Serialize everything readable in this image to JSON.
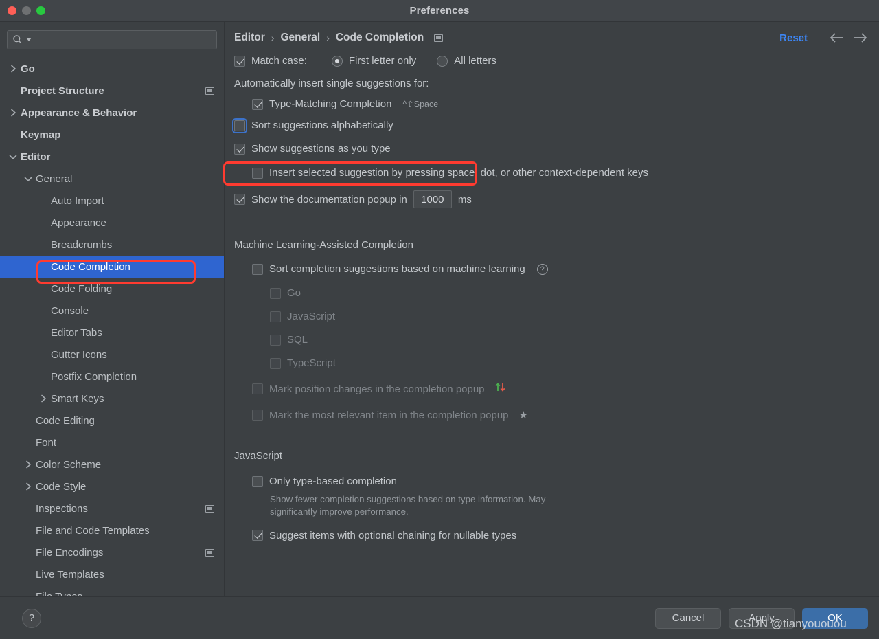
{
  "window": {
    "title": "Preferences",
    "traffic_lights": [
      "close",
      "minimize",
      "zoom"
    ]
  },
  "sidebar": {
    "search": {
      "placeholder": "",
      "value": ""
    },
    "items": [
      {
        "label": "Go",
        "arrow": "right",
        "bold": true,
        "indent": 0,
        "badge": false,
        "selected": false
      },
      {
        "label": "Project Structure",
        "arrow": "none",
        "bold": true,
        "indent": 0,
        "badge": true,
        "selected": false
      },
      {
        "label": "Appearance & Behavior",
        "arrow": "right",
        "bold": true,
        "indent": 0,
        "badge": false,
        "selected": false
      },
      {
        "label": "Keymap",
        "arrow": "none",
        "bold": true,
        "indent": 0,
        "badge": false,
        "selected": false
      },
      {
        "label": "Editor",
        "arrow": "down",
        "bold": true,
        "indent": 0,
        "badge": false,
        "selected": false
      },
      {
        "label": "General",
        "arrow": "down",
        "bold": false,
        "indent": 1,
        "badge": false,
        "selected": false
      },
      {
        "label": "Auto Import",
        "arrow": "none",
        "bold": false,
        "indent": 2,
        "badge": false,
        "selected": false
      },
      {
        "label": "Appearance",
        "arrow": "none",
        "bold": false,
        "indent": 2,
        "badge": false,
        "selected": false
      },
      {
        "label": "Breadcrumbs",
        "arrow": "none",
        "bold": false,
        "indent": 2,
        "badge": false,
        "selected": false
      },
      {
        "label": "Code Completion",
        "arrow": "none",
        "bold": false,
        "indent": 2,
        "badge": false,
        "selected": true
      },
      {
        "label": "Code Folding",
        "arrow": "none",
        "bold": false,
        "indent": 2,
        "badge": false,
        "selected": false
      },
      {
        "label": "Console",
        "arrow": "none",
        "bold": false,
        "indent": 2,
        "badge": false,
        "selected": false
      },
      {
        "label": "Editor Tabs",
        "arrow": "none",
        "bold": false,
        "indent": 2,
        "badge": false,
        "selected": false
      },
      {
        "label": "Gutter Icons",
        "arrow": "none",
        "bold": false,
        "indent": 2,
        "badge": false,
        "selected": false
      },
      {
        "label": "Postfix Completion",
        "arrow": "none",
        "bold": false,
        "indent": 2,
        "badge": false,
        "selected": false
      },
      {
        "label": "Smart Keys",
        "arrow": "right",
        "bold": false,
        "indent": 2,
        "badge": false,
        "selected": false
      },
      {
        "label": "Code Editing",
        "arrow": "none",
        "bold": false,
        "indent": 1,
        "badge": false,
        "selected": false
      },
      {
        "label": "Font",
        "arrow": "none",
        "bold": false,
        "indent": 1,
        "badge": false,
        "selected": false
      },
      {
        "label": "Color Scheme",
        "arrow": "right",
        "bold": false,
        "indent": 1,
        "badge": false,
        "selected": false
      },
      {
        "label": "Code Style",
        "arrow": "right",
        "bold": false,
        "indent": 1,
        "badge": false,
        "selected": false
      },
      {
        "label": "Inspections",
        "arrow": "none",
        "bold": false,
        "indent": 1,
        "badge": true,
        "selected": false
      },
      {
        "label": "File and Code Templates",
        "arrow": "none",
        "bold": false,
        "indent": 1,
        "badge": false,
        "selected": false
      },
      {
        "label": "File Encodings",
        "arrow": "none",
        "bold": false,
        "indent": 1,
        "badge": true,
        "selected": false
      },
      {
        "label": "Live Templates",
        "arrow": "none",
        "bold": false,
        "indent": 1,
        "badge": false,
        "selected": false
      },
      {
        "label": "File Types",
        "arrow": "none",
        "bold": false,
        "indent": 1,
        "badge": false,
        "selected": false
      }
    ]
  },
  "breadcrumb": {
    "parts": [
      "Editor",
      "General",
      "Code Completion"
    ],
    "separator": "›",
    "reset_label": "Reset",
    "back_icon": "arrow-left-icon",
    "forward_icon": "arrow-right-icon",
    "badge_icon": "copy-settings-icon"
  },
  "main": {
    "match_case": {
      "label": "Match case:",
      "checked": true,
      "options": [
        {
          "label": "First letter only",
          "selected": true
        },
        {
          "label": "All letters",
          "selected": false
        }
      ]
    },
    "auto_insert_header": "Automatically insert single suggestions for:",
    "type_matching": {
      "label": "Type-Matching Completion",
      "shortcut": "^⇧Space",
      "checked": true
    },
    "sort_alphabetically": {
      "label": "Sort suggestions alphabetically",
      "checked": false,
      "focused": true
    },
    "show_as_you_type": {
      "label": "Show suggestions as you type",
      "checked": true,
      "highlighted": true
    },
    "insert_selected": {
      "label": "Insert selected suggestion by pressing space, dot, or other context-dependent keys",
      "checked": false
    },
    "doc_popup": {
      "label": "Show the documentation popup in",
      "checked": true,
      "delay_value": "1000",
      "unit": "ms"
    },
    "ml_section": {
      "title": "Machine Learning-Assisted Completion",
      "sort_ml": {
        "label": "Sort completion suggestions based on machine learning",
        "checked": false,
        "help_icon": "question-mark-icon"
      },
      "languages": [
        {
          "label": "Go",
          "checked": false
        },
        {
          "label": "JavaScript",
          "checked": false
        },
        {
          "label": "SQL",
          "checked": false
        },
        {
          "label": "TypeScript",
          "checked": false
        }
      ],
      "mark_position": {
        "label": "Mark position changes in the completion popup",
        "checked": false,
        "icon": "up-down-arrows-icon"
      },
      "mark_relevant": {
        "label": "Mark the most relevant item in the completion popup",
        "checked": false,
        "icon": "star-icon"
      }
    },
    "js_section": {
      "title": "JavaScript",
      "only_type_based": {
        "label": "Only type-based completion",
        "checked": false,
        "description": "Show fewer completion suggestions based on type information. May significantly improve performance."
      },
      "optional_chaining": {
        "label": "Suggest items with optional chaining for nullable types",
        "checked": true
      }
    }
  },
  "footer": {
    "help_label": "?",
    "cancel_label": "Cancel",
    "apply_label": "Apply",
    "ok_label": "OK"
  },
  "watermark": {
    "text": "CSDN @tianyououou"
  },
  "colors": {
    "accent_blue": "#2f65d0",
    "link_blue": "#3d86f5",
    "primary_button": "#3b6ea8",
    "highlight_red": "#ff3b30",
    "window_bg": "#3c4043",
    "titlebar_bg": "#414549"
  }
}
